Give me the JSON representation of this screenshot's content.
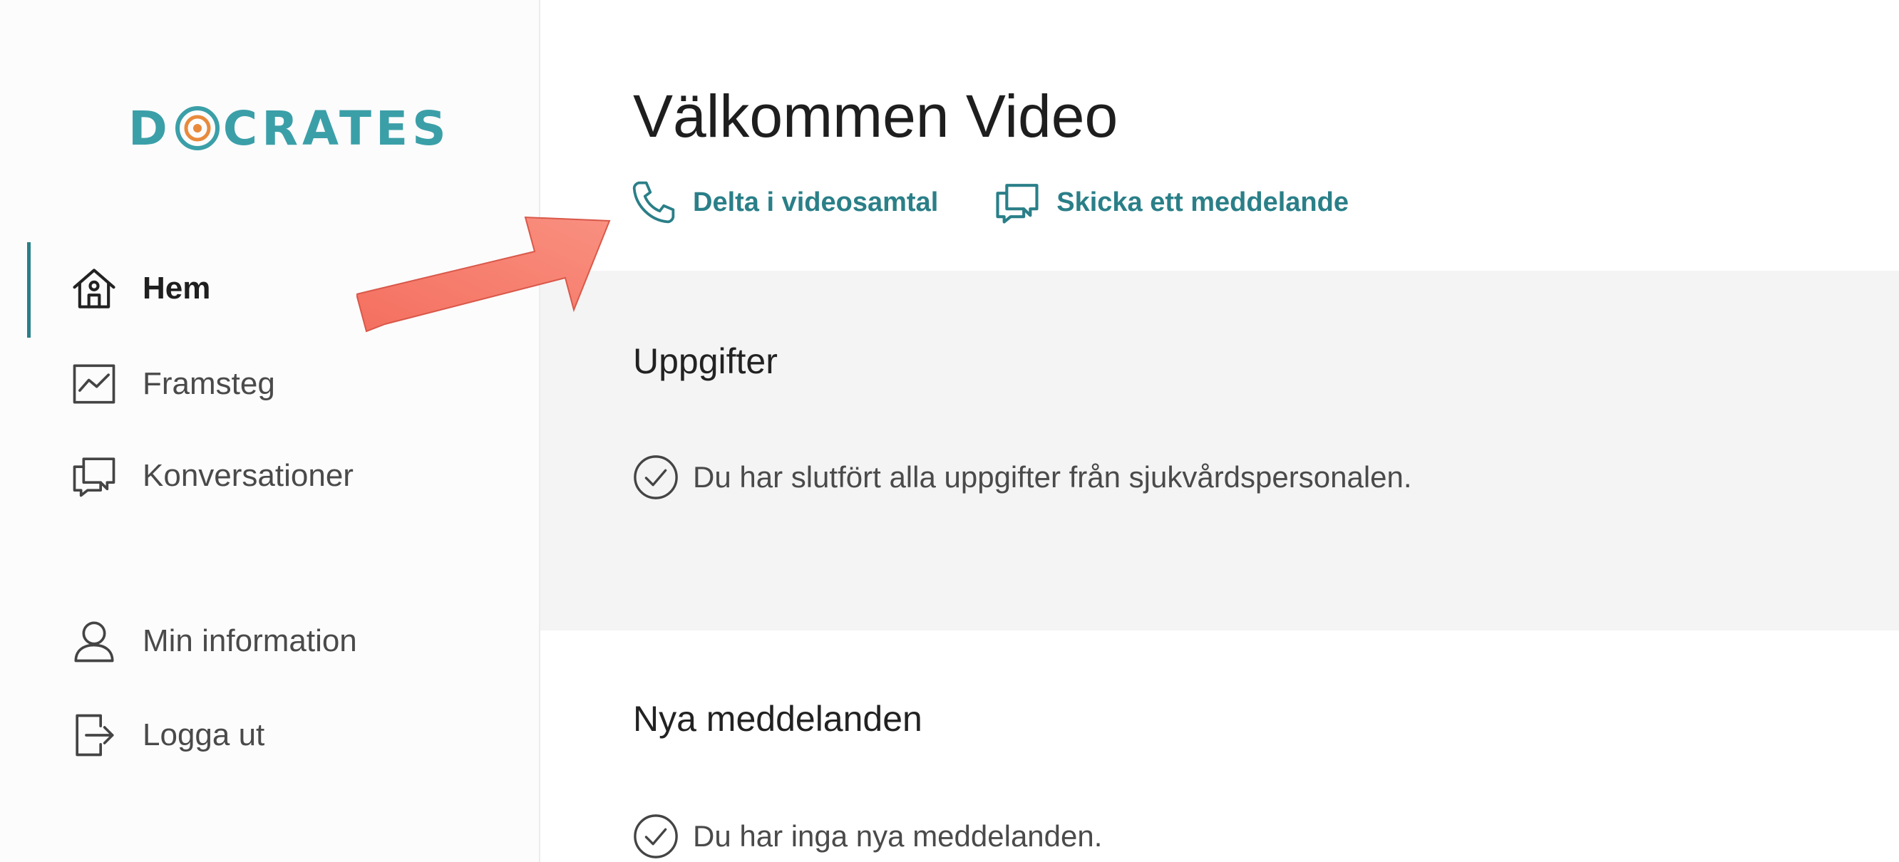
{
  "app": {
    "logo_text_left": "D",
    "logo_text_right": "CRATES",
    "accent_color": "#2a7f88",
    "logo_color": "#3b9fa8"
  },
  "sidebar": {
    "items": [
      {
        "label": "Hem",
        "icon": "home-icon",
        "active": true
      },
      {
        "label": "Framsteg",
        "icon": "chart-icon",
        "active": false
      },
      {
        "label": "Konversationer",
        "icon": "chat-icon",
        "active": false
      },
      {
        "label": "Min information",
        "icon": "user-icon",
        "active": false
      },
      {
        "label": "Logga ut",
        "icon": "logout-icon",
        "active": false
      }
    ]
  },
  "main": {
    "title": "Välkommen Video",
    "actions": [
      {
        "label": "Delta i videosamtal",
        "icon": "phone-icon"
      },
      {
        "label": "Skicka ett meddelande",
        "icon": "chat-icon"
      }
    ],
    "tasks": {
      "title": "Uppgifter",
      "status": "Du har slutfört alla uppgifter från sjukvårdspersonalen."
    },
    "messages": {
      "title": "Nya meddelanden",
      "status": "Du har inga nya meddelanden."
    }
  },
  "annotation": {
    "arrow_color": "#f47f6b"
  }
}
